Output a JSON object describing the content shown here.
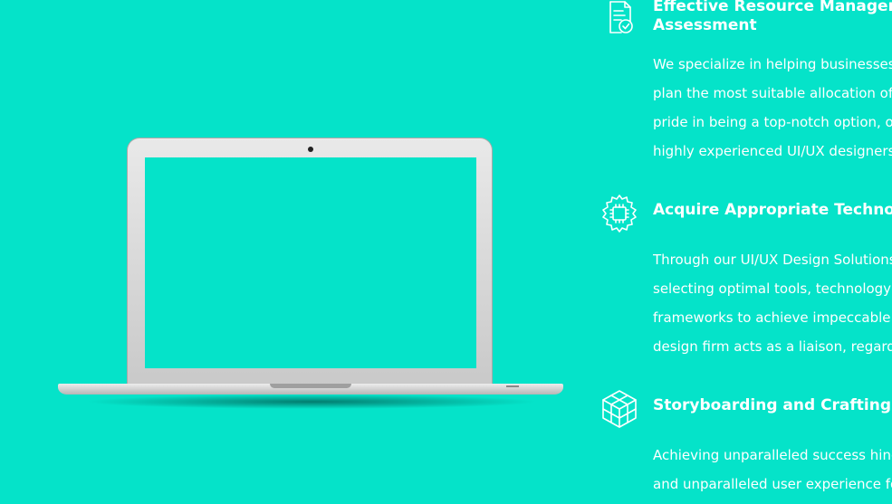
{
  "features": [
    {
      "icon": "clipboard-check-icon",
      "title_line1": "Effective Resource Management",
      "title_line2": "Assessment",
      "lines": [
        "We specialize in helping businesses",
        "plan the most suitable allocation of t",
        "pride in being a top-notch option, of",
        "highly experienced UI/UX designers."
      ]
    },
    {
      "icon": "chip-gear-icon",
      "title_line1": "Acquire Appropriate Technolog",
      "lines": [
        "Through our UI/UX Design Solutions",
        "selecting optimal tools, technology s",
        "frameworks to achieve impeccable U",
        "design firm acts as a liaison, regardl"
      ]
    },
    {
      "icon": "cube-icon",
      "title_line1": "Storyboarding and Crafting Ex",
      "lines": [
        "Achieving unparalleled success hing",
        "and unparalleled user experience for"
      ]
    }
  ]
}
